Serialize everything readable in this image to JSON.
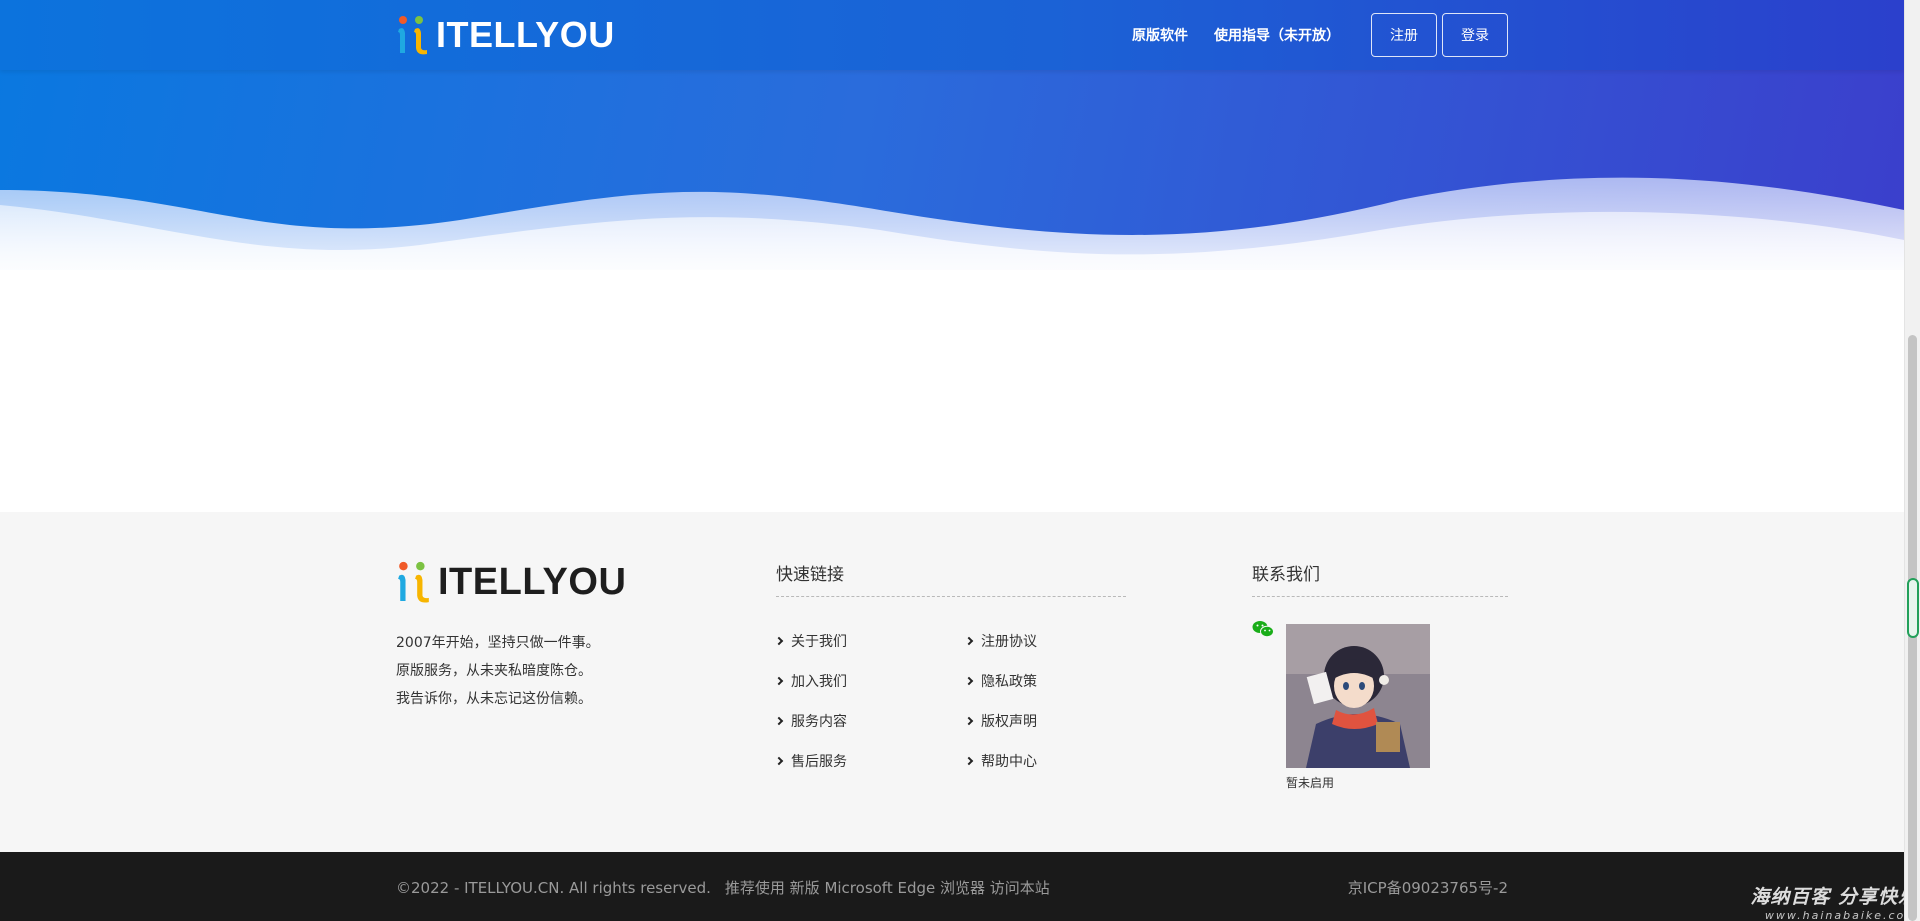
{
  "header": {
    "brand": "ITELLYOU",
    "nav": {
      "software": "原版软件",
      "guide": "使用指导（未开放）",
      "register": "注册",
      "login": "登录"
    }
  },
  "footer": {
    "brand": "ITELLYOU",
    "about_lines": [
      "2007年开始，坚持只做一件事。",
      "原版服务，从未夹私暗度陈仓。",
      "我告诉你，从未忘记这份信赖。"
    ],
    "quick_links": {
      "title": "快速链接",
      "items": [
        "关于我们",
        "注册协议",
        "加入我们",
        "隐私政策",
        "服务内容",
        "版权声明",
        "售后服务",
        "帮助中心"
      ]
    },
    "contact": {
      "title": "联系我们",
      "qr_caption": "暂未启用"
    }
  },
  "bottom": {
    "copyright": "©2022 - ITELLYOU.CN. All rights reserved.",
    "recommend": "推荐使用 新版 Microsoft Edge 浏览器 访问本站",
    "icp": "京ICP备09023765号-2"
  },
  "watermark": {
    "title": "海纳百客 分享快乐",
    "url": "www.hainabaike.com"
  },
  "colors": {
    "header_start": "#0c73dd",
    "header_end": "#2b40cc",
    "footer_bg": "#f6f6f6",
    "bottom_bg": "#1a1a1a",
    "wechat_green": "#1aad19"
  },
  "icons": {
    "logo": "itellyou-logo-icon",
    "link_bullet": "chevron-right-icon",
    "wechat": "wechat-icon"
  }
}
